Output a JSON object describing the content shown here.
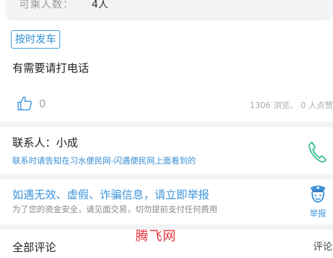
{
  "seats": {
    "label": "可乘人数：",
    "value": "4人"
  },
  "post": {
    "tag": "按时发车",
    "note": "有需要请打电话",
    "like_count": "0",
    "stats": "1306 浏览、 0 人点赞"
  },
  "contact": {
    "name": "联系人：小成",
    "note": "联系时请告知在习水便民网-闪遇便民网上面看到的",
    "phone_icon": "phone-icon"
  },
  "report": {
    "title": "如遇无效、虚假、诈骗信息，请立即举报",
    "subtitle": "为了您的资金安全，请见面交易，切勿提前支付任何费用",
    "button_label": "举报",
    "icon": "police-icon"
  },
  "comments": {
    "title": "全部评论",
    "link": "评论"
  },
  "watermark": "腾飞网",
  "colors": {
    "accent": "#3b94dd",
    "phone": "#3cc28f",
    "watermark": "#e8353a",
    "background": "#f2f3f5"
  }
}
